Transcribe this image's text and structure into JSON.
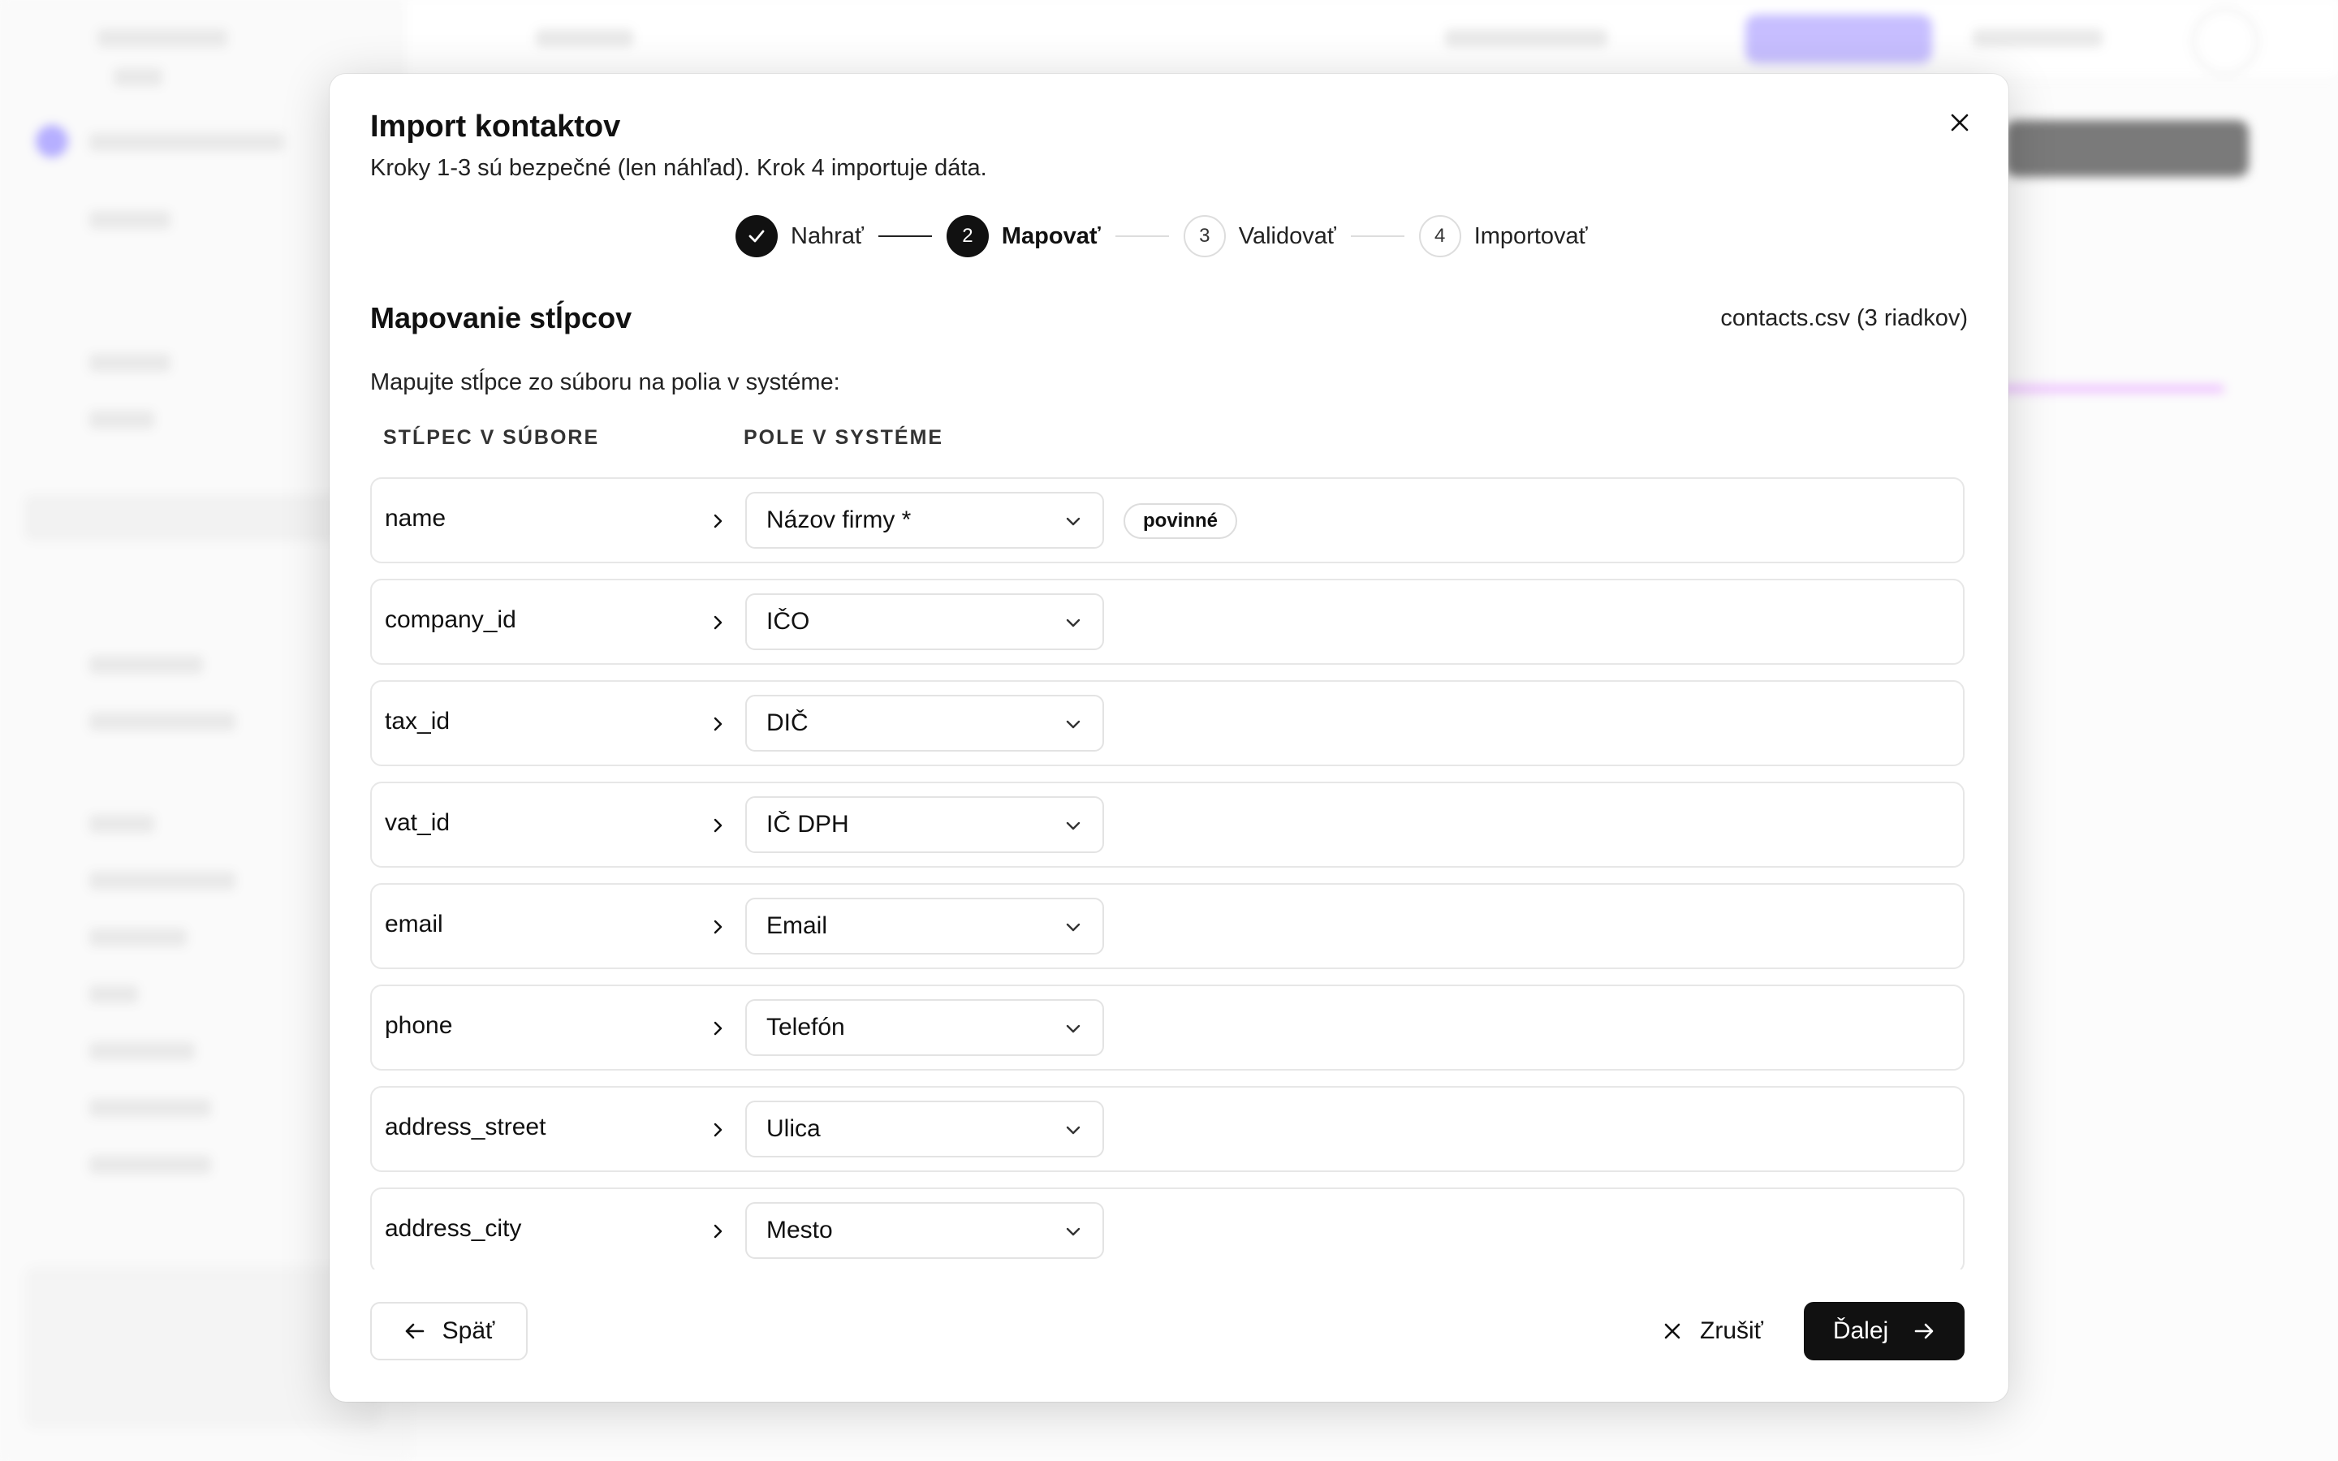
{
  "modal": {
    "title": "Import kontaktov",
    "subtitle": "Kroky 1-3 sú bezpečné (len náhľad). Krok 4 importuje dáta.",
    "steps": [
      {
        "number": "",
        "label": "Nahrať",
        "state": "done"
      },
      {
        "number": "2",
        "label": "Mapovať",
        "state": "active"
      },
      {
        "number": "3",
        "label": "Validovať",
        "state": "todo"
      },
      {
        "number": "4",
        "label": "Importovať",
        "state": "todo"
      }
    ],
    "section_title": "Mapovanie stĺpcov",
    "file_info": "contacts.csv (3 riadkov)",
    "instruction": "Mapujte stĺpce zo súboru na polia v systéme:",
    "col_source": "STĹPEC V SÚBORE",
    "col_target": "POLE V SYSTÉME",
    "rows": [
      {
        "source": "name",
        "target": "Názov firmy *",
        "badge": "povinné"
      },
      {
        "source": "company_id",
        "target": "IČO"
      },
      {
        "source": "tax_id",
        "target": "DIČ"
      },
      {
        "source": "vat_id",
        "target": "IČ DPH"
      },
      {
        "source": "email",
        "target": "Email"
      },
      {
        "source": "phone",
        "target": "Telefón"
      },
      {
        "source": "address_street",
        "target": "Ulica"
      },
      {
        "source": "address_city",
        "target": "Mesto"
      }
    ],
    "back_label": "Späť",
    "cancel_label": "Zrušiť",
    "next_label": "Ďalej"
  },
  "colors": {
    "primary": "#111111",
    "border": "#e3e3e3",
    "background_accent": "#7c6cf2"
  }
}
